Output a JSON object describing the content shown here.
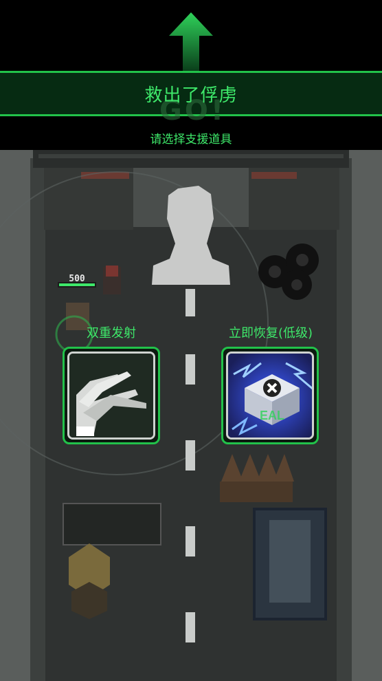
{
  "banner": {
    "title": "救出了俘虏"
  },
  "subtitle": "请选择支援道具",
  "hud": {
    "enemy_hp": "500"
  },
  "skills": [
    {
      "label": "双重发射",
      "icon": "double-gun-icon"
    },
    {
      "label": "立即恢复(低级)",
      "icon": "medkit-lightning-icon"
    }
  ],
  "colors": {
    "accent": "#3ee86a",
    "banner_bg": "#062b12",
    "border": "#22c24a"
  }
}
